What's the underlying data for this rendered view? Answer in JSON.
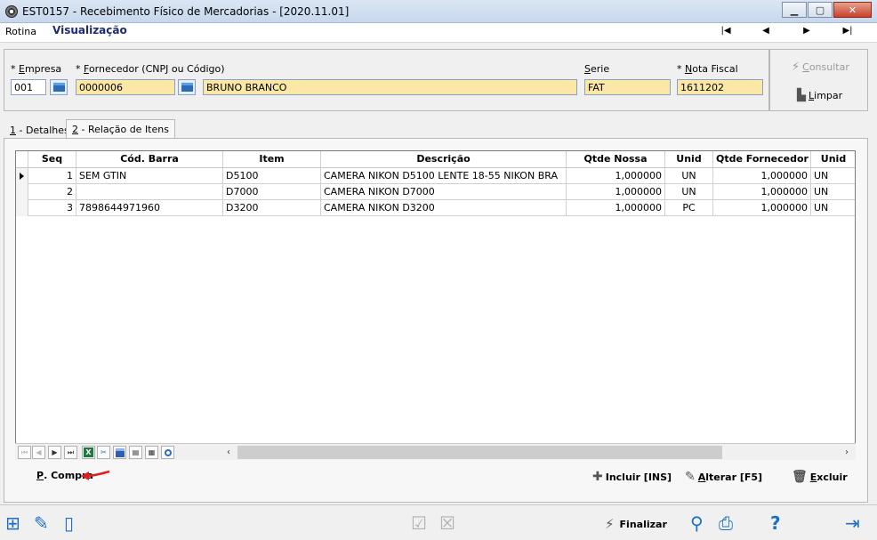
{
  "window": {
    "title": "EST0157 - Recebimento Físico de Mercadorias - [2020.11.01]",
    "minimize": "▁",
    "restore": "▢",
    "close": "✕"
  },
  "menu": {
    "rotina": "Rotina",
    "mode": "Visualização",
    "nav_first": "|◀",
    "nav_prev": "◀",
    "nav_next": "▶",
    "nav_last": "▶|"
  },
  "header": {
    "empresa_label_req": "* ",
    "empresa_label_key": "E",
    "empresa_label_rest": "mpresa",
    "empresa_value": "001",
    "fornecedor_label_req": "* ",
    "fornecedor_label_key": "F",
    "fornecedor_label_rest": "ornecedor (CNPJ ou Código)",
    "fornecedor_code": "0000006",
    "fornecedor_name": "BRUNO BRANCO",
    "serie_label_key": "S",
    "serie_label_rest": "erie",
    "serie_value": "FAT",
    "nota_label_req": "* ",
    "nota_label_key": "N",
    "nota_label_rest": "ota Fiscal",
    "nota_value": "1611202"
  },
  "side": {
    "consultar_key": "C",
    "consultar_rest": "onsultar",
    "limpar_key": "L",
    "limpar_rest": "impar"
  },
  "tabs": [
    {
      "key": "1",
      "label": " - Detalhes"
    },
    {
      "key": "2",
      "label": " - Relação de Itens"
    }
  ],
  "grid": {
    "columns": [
      "Seq",
      "Cód. Barra",
      "Item",
      "Descrição",
      "Qtde Nossa",
      "Unid",
      "Qtde Fornecedor",
      "Unid"
    ],
    "rows": [
      {
        "seq": "1",
        "barcode": "SEM GTIN",
        "item": "D5100",
        "descricao": "CAMERA NIKON D5100 LENTE 18-55 NIKON BRA",
        "qtde_nossa": "1,000000",
        "unid": "UN",
        "qtde_forn": "1,000000",
        "unid_forn": "UN"
      },
      {
        "seq": "2",
        "barcode": "",
        "item": "D7000",
        "descricao": "CAMERA NIKON D7000",
        "qtde_nossa": "1,000000",
        "unid": "UN",
        "qtde_forn": "1,000000",
        "unid_forn": "UN"
      },
      {
        "seq": "3",
        "barcode": "7898644971960",
        "item": "D3200",
        "descricao": "CAMERA NIKON D3200",
        "qtde_nossa": "1,000000",
        "unid": "PC",
        "qtde_forn": "1,000000",
        "unid_forn": "UN"
      }
    ]
  },
  "grid_toolbar": {
    "first": "⏮",
    "prev": "◀",
    "next": "▶",
    "last": "⏭",
    "excel": "X",
    "scroll_left": "‹",
    "scroll_right": "›"
  },
  "actions": {
    "pcompra_key": "P",
    "pcompra_rest": ". Compra",
    "incluir": "Incluir [INS]",
    "alterar_key": "A",
    "alterar_rest": "lterar [F5]",
    "excluir_key": "E",
    "excluir_rest": "xcluir"
  },
  "footer": {
    "finalizar": "Finalizar",
    "help": "?"
  },
  "colors": {
    "required_field": "#fbe8a6",
    "mode_text": "#1c2b74",
    "accent_blue": "#1d6fc2",
    "arrow_red": "#e21d1d"
  }
}
